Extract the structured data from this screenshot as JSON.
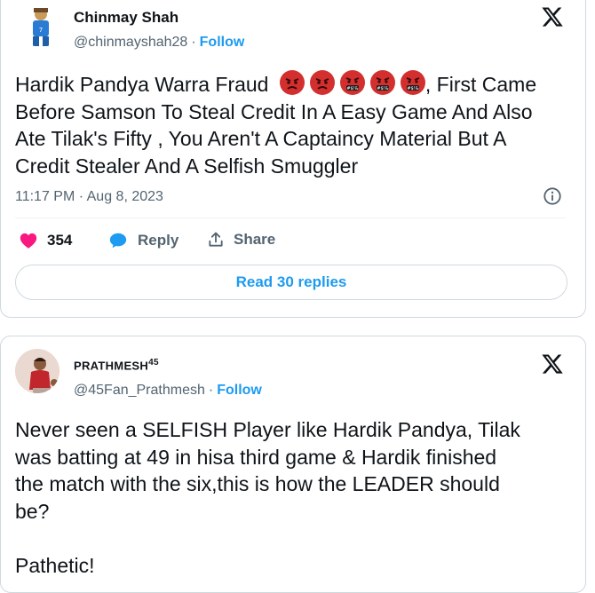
{
  "tweet1": {
    "display_name": "Chinmay Shah",
    "handle": "@chinmayshah28",
    "separator": "·",
    "follow_label": "Follow",
    "text_lines": [
      "Hardik Pandya Warra Fraud",
      ", First Came",
      "Before Samson To Steal Credit In A Easy Game And Also",
      "Ate Tilak's Fifty , You Aren't A Captaincy Material But A",
      "Credit Stealer And A Selfish Smuggler"
    ],
    "emojis": [
      "pouting-face",
      "pouting-face",
      "face-with-symbols-on-mouth",
      "face-with-symbols-on-mouth",
      "face-with-symbols-on-mouth"
    ],
    "timestamp": "11:17 PM · Aug 8, 2023",
    "likes": "354",
    "reply_label": "Reply",
    "share_label": "Share",
    "read_replies_label": "Read 30 replies"
  },
  "tweet2": {
    "display_name": "PRATHMESH",
    "display_name_sup": "45",
    "handle": "@45Fan_Prathmesh",
    "separator": "·",
    "follow_label": "Follow",
    "text_lines": [
      "Never seen a SELFISH Player like Hardik Pandya, Tilak",
      "was batting at 49 in hisa third game & Hardik finished",
      "the match with the six,this is how the LEADER should",
      "be?",
      "",
      "Pathetic!"
    ]
  },
  "colors": {
    "accent": "#1d9bf0",
    "like": "#f91880",
    "text": "#0f1419",
    "secondary": "#536471",
    "border": "#cfd9de",
    "emoji_red": "#d32f2f"
  }
}
